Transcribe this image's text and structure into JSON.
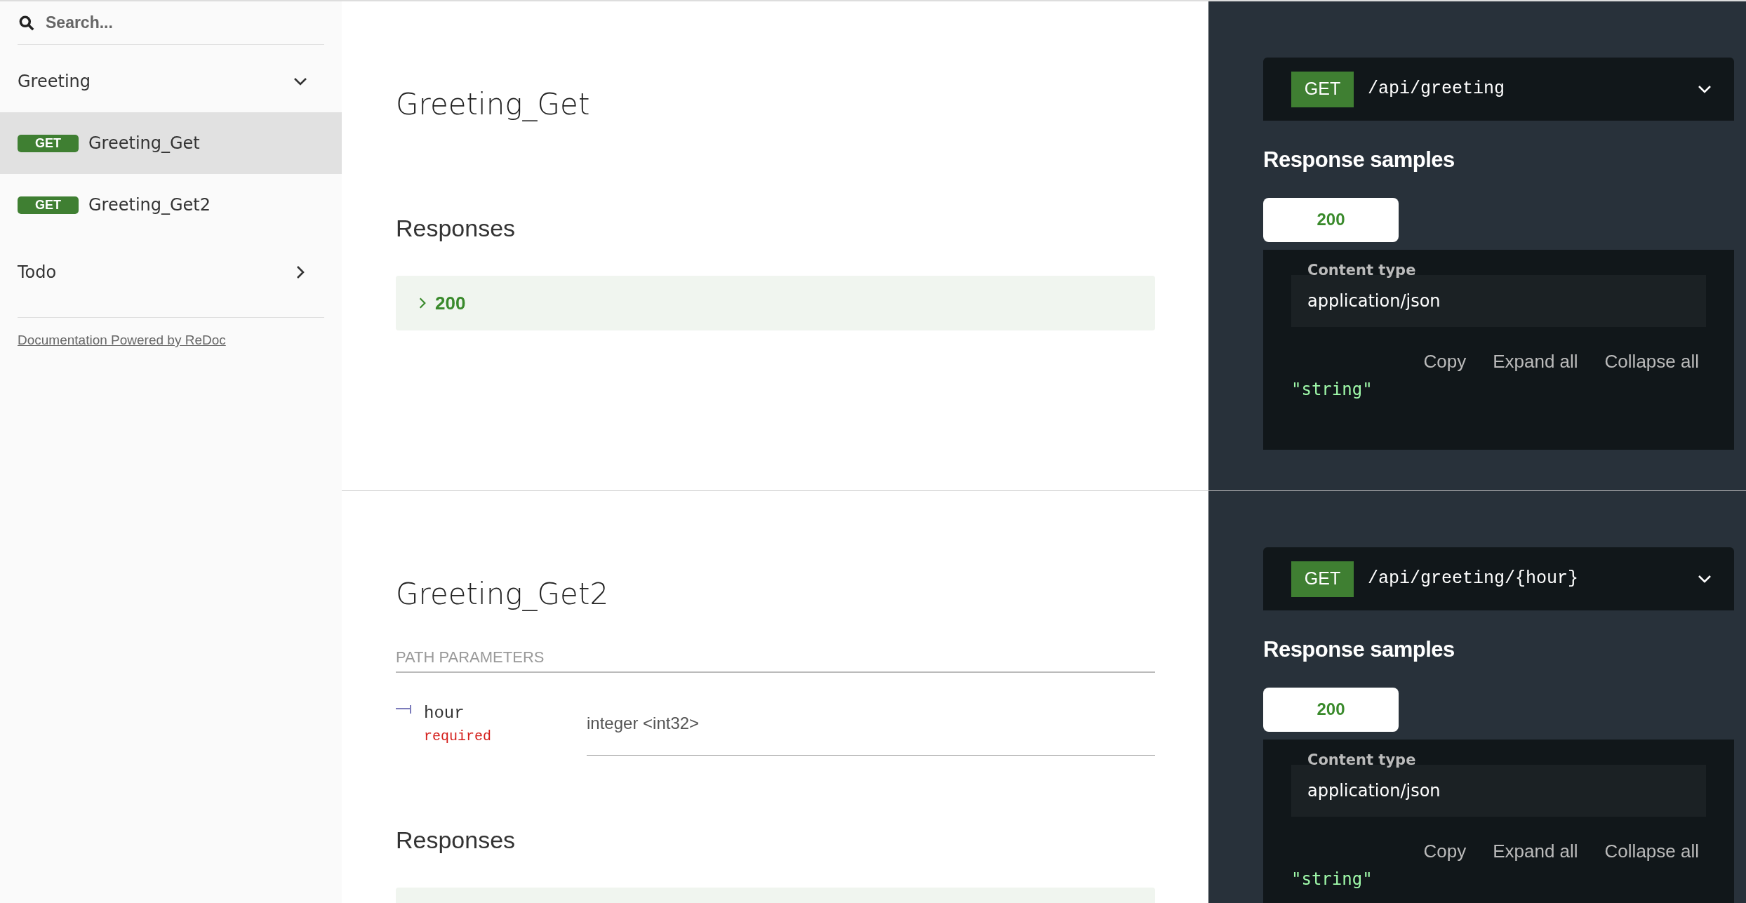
{
  "sidebar": {
    "search": {
      "placeholder": "Search..."
    },
    "groups": [
      {
        "label": "Greeting",
        "expanded": true,
        "children": [
          {
            "method": "GET",
            "label": "Greeting_Get",
            "selected": true
          },
          {
            "method": "GET",
            "label": "Greeting_Get2",
            "selected": false
          }
        ]
      },
      {
        "label": "Todo",
        "expanded": false
      }
    ],
    "footer_link": "Documentation Powered by ReDoc"
  },
  "operations": [
    {
      "title": "Greeting_Get",
      "responses_heading": "Responses",
      "responses": [
        {
          "code": "200",
          "expanded": false
        }
      ],
      "endpoint": {
        "method": "GET",
        "path": "/api/greeting",
        "expanded": false
      },
      "samples_heading": "Response samples",
      "sample_tabs": [
        {
          "label": "200",
          "selected": true
        }
      ],
      "content_type_label": "Content type",
      "content_type": "application/json",
      "actions": [
        "Copy",
        "Expand all",
        "Collapse all"
      ],
      "sample": "\"string\""
    },
    {
      "title": "Greeting_Get2",
      "parameters_heading": "PATH PARAMETERS",
      "parameters": [
        {
          "name": "hour",
          "required_label": "required",
          "type": "integer <int32>"
        }
      ],
      "responses_heading": "Responses",
      "responses_cut_off": true,
      "endpoint": {
        "method": "GET",
        "path": "/api/greeting/{hour}",
        "expanded": false
      },
      "samples_heading": "Response samples",
      "sample_tabs": [
        {
          "label": "200",
          "selected": true
        }
      ],
      "content_type_label": "Content type",
      "content_type": "application/json",
      "actions": [
        "Copy",
        "Expand all",
        "Collapse all"
      ],
      "sample": "\"string\""
    }
  ]
}
